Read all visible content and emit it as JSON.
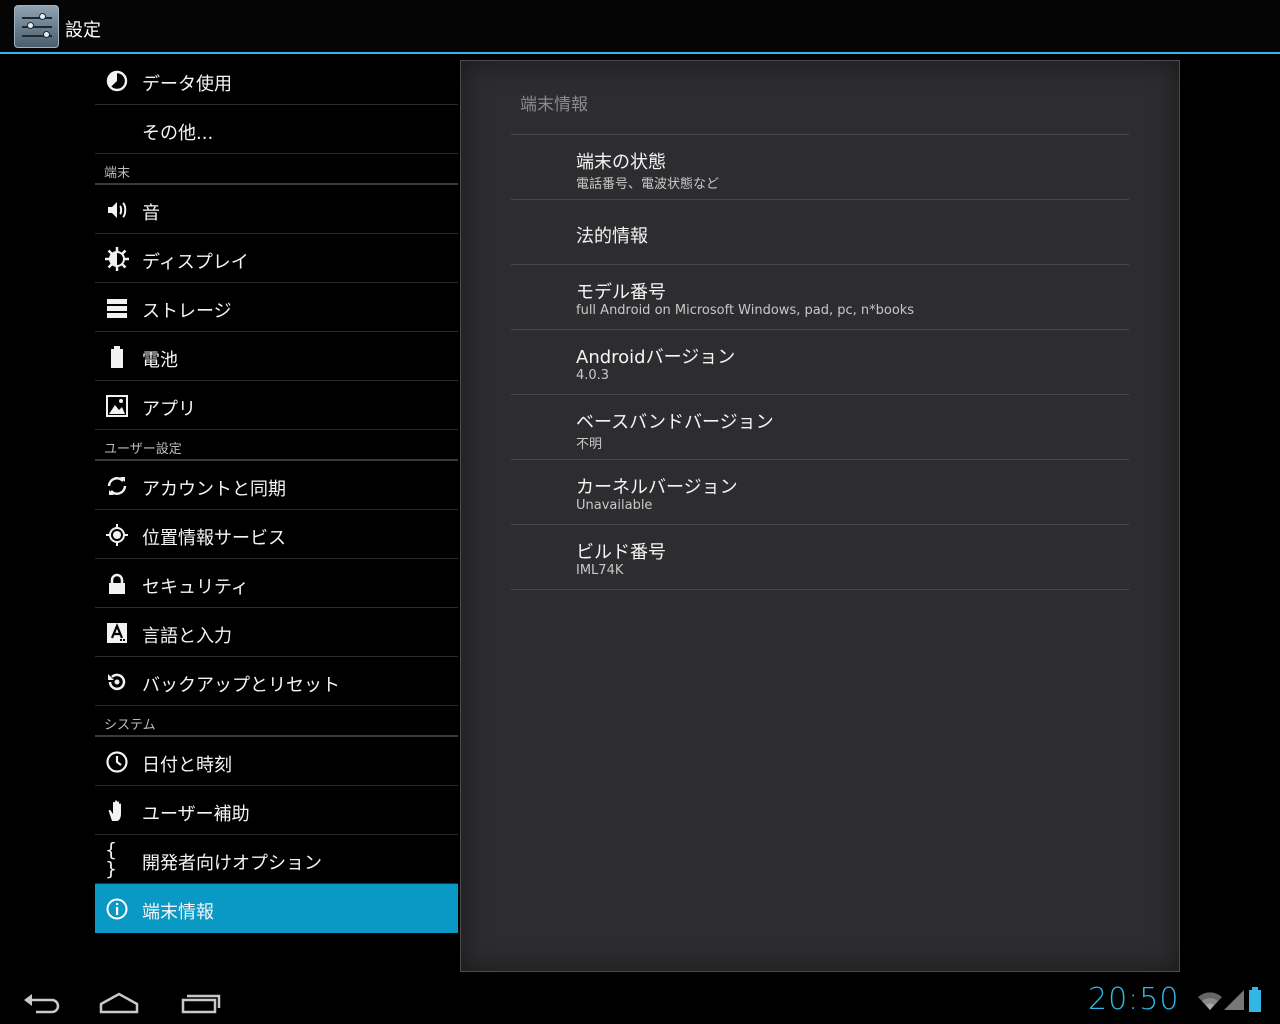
{
  "app": {
    "title": "設定"
  },
  "sidebar": {
    "top_items": [
      {
        "label": "データ使用",
        "icon": "data-usage-icon"
      },
      {
        "label": "その他...",
        "icon": ""
      }
    ],
    "categories": [
      {
        "title": "端末",
        "items": [
          {
            "label": "音",
            "icon": "sound-icon"
          },
          {
            "label": "ディスプレイ",
            "icon": "display-icon"
          },
          {
            "label": "ストレージ",
            "icon": "storage-icon"
          },
          {
            "label": "電池",
            "icon": "battery-icon"
          },
          {
            "label": "アプリ",
            "icon": "apps-icon"
          }
        ]
      },
      {
        "title": "ユーザー設定",
        "items": [
          {
            "label": "アカウントと同期",
            "icon": "sync-icon"
          },
          {
            "label": "位置情報サービス",
            "icon": "location-icon"
          },
          {
            "label": "セキュリティ",
            "icon": "lock-icon"
          },
          {
            "label": "言語と入力",
            "icon": "language-icon"
          },
          {
            "label": "バックアップとリセット",
            "icon": "backup-icon"
          }
        ]
      },
      {
        "title": "システム",
        "items": [
          {
            "label": "日付と時刻",
            "icon": "clock-icon"
          },
          {
            "label": "ユーザー補助",
            "icon": "accessibility-hand-icon"
          },
          {
            "label": "開発者向けオプション",
            "icon": "developer-braces-icon"
          },
          {
            "label": "端末情報",
            "icon": "info-icon",
            "selected": true
          }
        ]
      }
    ]
  },
  "panel": {
    "title": "端末情報",
    "prefs": [
      {
        "title": "端末の状態",
        "summary": "電話番号、電波状態など"
      },
      {
        "title": "法的情報",
        "summary": ""
      },
      {
        "title": "モデル番号",
        "summary": "full Android on Microsoft Windows, pad, pc, n*books"
      },
      {
        "title": "Androidバージョン",
        "summary": "4.0.3"
      },
      {
        "title": "ベースバンドバージョン",
        "summary": "不明"
      },
      {
        "title": "カーネルバージョン",
        "summary": "Unavailable"
      },
      {
        "title": "ビルド番号",
        "summary": "IML74K"
      }
    ]
  },
  "status": {
    "time": "20:50",
    "accent": "#33b5e5",
    "selected_color": "#0a99c5"
  },
  "navbar": {
    "buttons": [
      "back-icon",
      "home-icon",
      "recent-apps-icon"
    ]
  }
}
